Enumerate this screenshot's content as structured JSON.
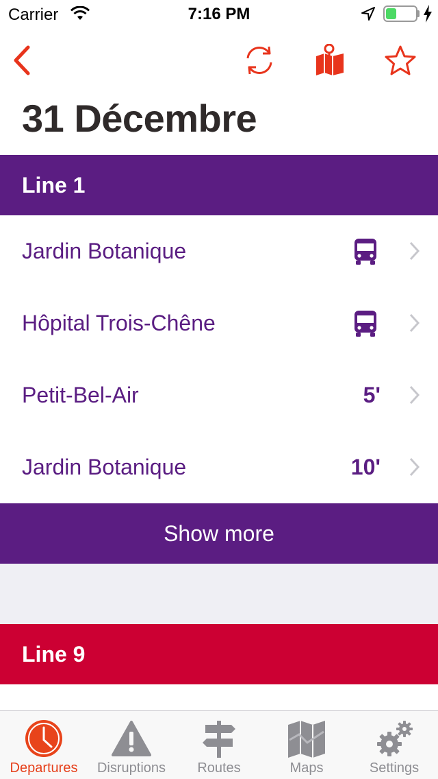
{
  "status_bar": {
    "carrier": "Carrier",
    "time": "7:16 PM",
    "battery_level": 0.35
  },
  "nav": {
    "icons": [
      "back-chevron-icon",
      "refresh-icon",
      "map-pin-icon",
      "star-icon"
    ],
    "accent_color": "#e8341c"
  },
  "page": {
    "title": "31 Décembre"
  },
  "line1": {
    "header": "Line 1",
    "color": "#5b1d82",
    "departures": [
      {
        "destination": "Jardin Botanique",
        "time": "",
        "icon": "bus-icon"
      },
      {
        "destination": "Hôpital Trois-Chêne",
        "time": "",
        "icon": "bus-icon"
      },
      {
        "destination": "Petit-Bel-Air",
        "time": "5'"
      },
      {
        "destination": "Jardin Botanique",
        "time": "10'"
      }
    ],
    "show_more": "Show more"
  },
  "line9": {
    "header": "Line 9",
    "color": "#cc0033"
  },
  "tab_bar": {
    "tabs": [
      {
        "label": "Departures",
        "icon": "clock-icon",
        "active": true
      },
      {
        "label": "Disruptions",
        "icon": "warning-icon",
        "active": false
      },
      {
        "label": "Routes",
        "icon": "signpost-icon",
        "active": false
      },
      {
        "label": "Maps",
        "icon": "map-icon",
        "active": false
      },
      {
        "label": "Settings",
        "icon": "gears-icon",
        "active": false
      }
    ]
  }
}
